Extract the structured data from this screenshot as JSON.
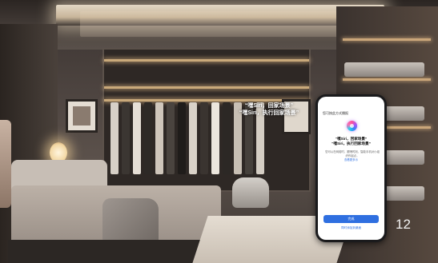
{
  "caption": {
    "line1": "“嘿Siri，回家场景”",
    "line2": "“嘿Siri，执行回家场景”"
  },
  "phone": {
    "header": "您可按此方式播报",
    "phrase1": "“嘿Siri，回家场景”",
    "phrase2": "“嘿Siri，执行回家场景”",
    "description": "您可以在网络时，跟嘿时刻，智能手机对小组织作起点，",
    "description_link": "查看更多示",
    "primary_button": "完成",
    "secondary_link": "同时添加到桌面"
  },
  "page_number": "12",
  "colors": {
    "accent": "#2f6fe0",
    "caption_text": "#ffffff"
  }
}
